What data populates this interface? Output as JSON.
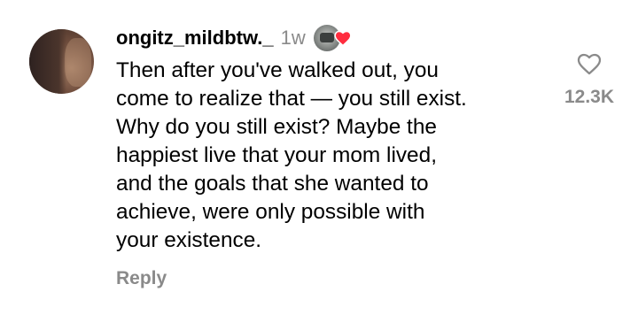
{
  "comment": {
    "username": "ongitz_mildbtw._",
    "time": "1w",
    "text_lines": [
      "Then after you've walked out, you",
      "come to realize that — you still exist.",
      "Why do you still exist? Maybe the",
      "happiest live that your mom lived,",
      "and the goals that she wanted to",
      "achieve, were only possible with",
      "your existence."
    ],
    "reply_label": "Reply",
    "like_count": "12.3K",
    "creator_liked": true
  },
  "colors": {
    "text": "#000000",
    "muted": "#8a8a8a",
    "heart_red": "#ff2d3f",
    "background": "#ffffff"
  },
  "icons": {
    "like": "heart-outline-icon",
    "creator_like": "heart-filled-icon"
  }
}
